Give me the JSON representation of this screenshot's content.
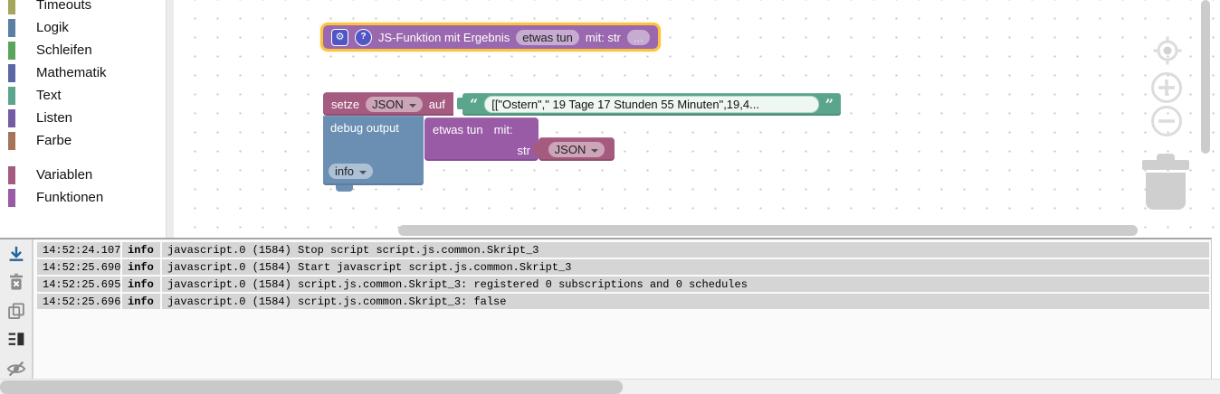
{
  "toolbox": {
    "items": [
      {
        "label": "Timeouts",
        "color": "#a5a55b"
      },
      {
        "label": "Logik",
        "color": "#5b80a5"
      },
      {
        "label": "Schleifen",
        "color": "#5ba55b"
      },
      {
        "label": "Mathematik",
        "color": "#5b67a5"
      },
      {
        "label": "Text",
        "color": "#5ba58c"
      },
      {
        "label": "Listen",
        "color": "#745ba5"
      },
      {
        "label": "Farbe",
        "color": "#a5745b"
      },
      {
        "label": "Variablen",
        "color": "#a55b80"
      },
      {
        "label": "Funktionen",
        "color": "#995ba5"
      }
    ]
  },
  "workspace": {
    "function_def_block": {
      "gear_icon": "⚙",
      "help_icon": "?",
      "title": "JS-Funktion mit Ergebnis",
      "name_value": "etwas tun",
      "args_label": "mit: str",
      "edit_label": "...",
      "color": "#9a68ae",
      "selected_outline_color": "#fdc23e"
    },
    "set_var_block": {
      "setze_label": "setze",
      "var_name": "JSON",
      "auf_label": "auf",
      "color": "#a55b80"
    },
    "text_block": {
      "quote_open": "“",
      "quote_close": "”",
      "value": "[[\"Ostern\",\" 19 Tage 17 Stunden 55 Minuten\",19,4...",
      "color": "#5ba58c"
    },
    "debug_block": {
      "label": "debug output",
      "level_value": "info",
      "color": "#6b8fb3"
    },
    "call_block": {
      "name": "etwas tun",
      "with_label": "mit:",
      "arg_label": "str",
      "color": "#995ba5"
    },
    "var_block": {
      "var_name": "JSON",
      "color": "#a55b80"
    },
    "controls": [
      "zoom-reset",
      "zoom-in",
      "zoom-out",
      "trash"
    ]
  },
  "log_panel": {
    "tool_icons": [
      "download-log",
      "clear-log",
      "copy-log",
      "select-lines",
      "hide-log"
    ],
    "rows": [
      {
        "time": "14:52:24.107",
        "severity": "info",
        "message": "javascript.0 (1584) Stop script script.js.common.Skript_3"
      },
      {
        "time": "14:52:25.690",
        "severity": "info",
        "message": "javascript.0 (1584) Start javascript script.js.common.Skript_3"
      },
      {
        "time": "14:52:25.695",
        "severity": "info",
        "message": "javascript.0 (1584) script.js.common.Skript_3: registered 0 subscriptions and 0 schedules"
      },
      {
        "time": "14:52:25.696",
        "severity": "info",
        "message": "javascript.0 (1584) script.js.common.Skript_3: false"
      }
    ]
  }
}
